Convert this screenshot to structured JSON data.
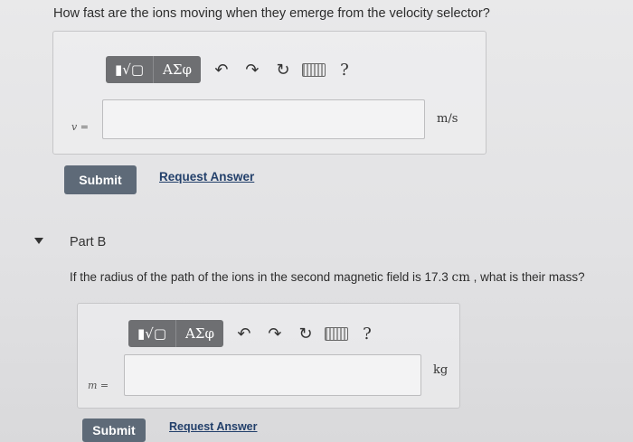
{
  "partA": {
    "question": "How fast are the ions moving when they emerge from the velocity selector?",
    "variable": "v =",
    "unit": "m/s",
    "toolbar": {
      "templates_glyph": "▮√▢",
      "symbols_label": "ΑΣφ",
      "help_label": "?"
    },
    "submit_label": "Submit",
    "request_label": "Request Answer"
  },
  "partB": {
    "title": "Part B",
    "question_prefix": "If the radius of the path of the ions in the second magnetic field is 17.3 ",
    "question_unit": "cm",
    "question_suffix": " , what is their mass?",
    "variable": "m =",
    "unit": "kg",
    "toolbar": {
      "templates_glyph": "▮√▢",
      "symbols_label": "ΑΣφ",
      "help_label": "?"
    },
    "submit_label": "Submit",
    "request_label": "Request Answer"
  }
}
